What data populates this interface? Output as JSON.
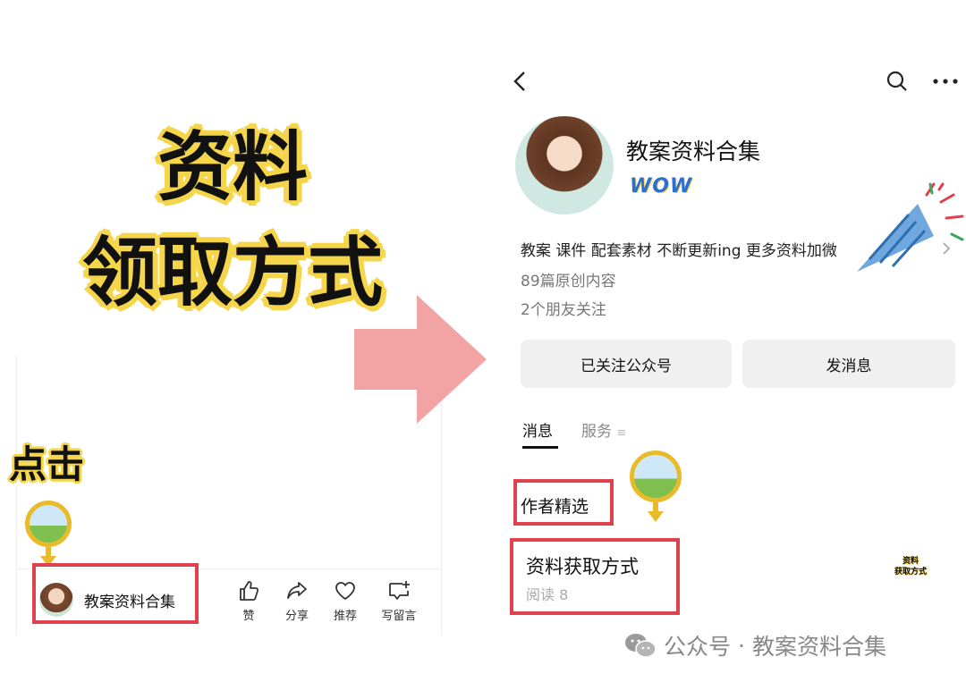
{
  "title": {
    "line1": "资料",
    "line2": "领取方式"
  },
  "click_label": "点击",
  "left_post": {
    "account_name": "教案资料合集",
    "actions": [
      {
        "label": "赞",
        "icon": "thumbs-up-icon"
      },
      {
        "label": "分享",
        "icon": "share-icon"
      },
      {
        "label": "推荐",
        "icon": "heart-icon"
      },
      {
        "label": "写留言",
        "icon": "comment-icon"
      }
    ]
  },
  "profile": {
    "name": "教案资料合集",
    "badge_text": "WOW",
    "description": "教案 课件 配套素材 不断更新ing 更多资料加微",
    "original_count": "89篇原创内容",
    "friends_following": "2个朋友关注",
    "follow_button": "已关注公众号",
    "message_button": "发消息",
    "tabs": [
      {
        "label": "消息",
        "active": true
      },
      {
        "label": "服务",
        "active": false
      }
    ],
    "section_label": "作者精选",
    "article": {
      "title": "资料获取方式",
      "reads": "阅读 8",
      "thumb_line1": "资料",
      "thumb_line2": "获取方式"
    }
  },
  "watermark": {
    "text_left": "公众号",
    "separator": "·",
    "text_right": "教案资料合集"
  },
  "colors": {
    "highlight_yellow": "#f5d54a",
    "pointer_yellow": "#e9bb2a",
    "red_box": "#e0414e",
    "arrow_pink": "#f2a3a3",
    "button_gray": "#f0f0f0"
  }
}
